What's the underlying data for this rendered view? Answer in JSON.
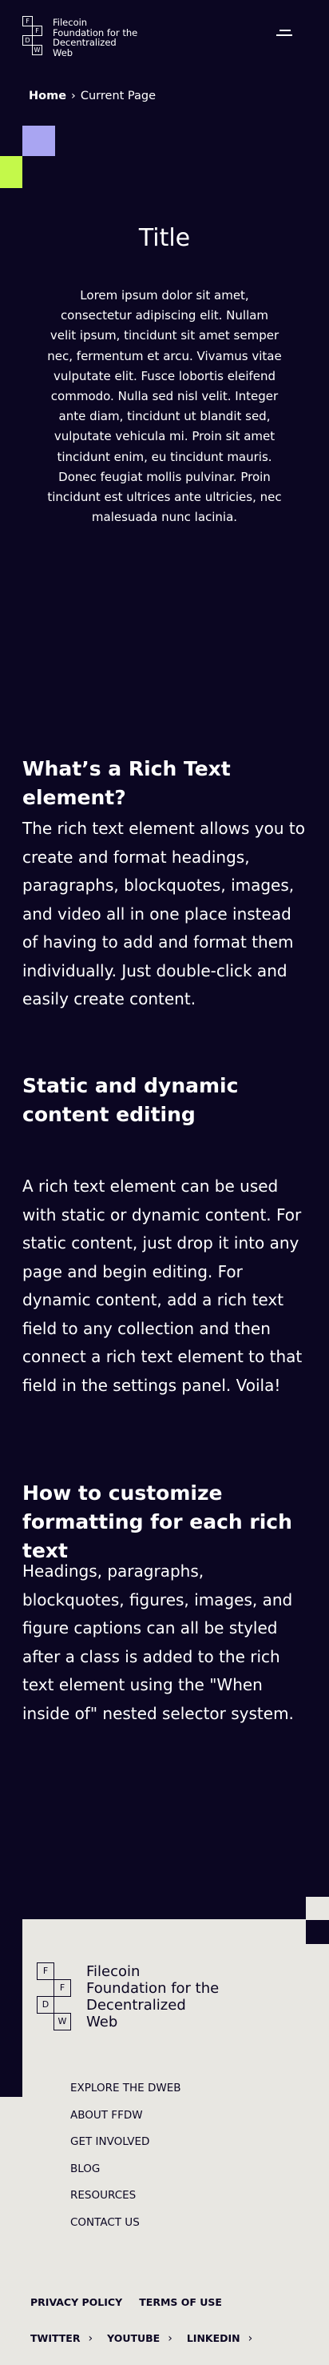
{
  "header": {
    "logo_cells": [
      "F",
      "F",
      "D",
      "W"
    ],
    "logo_text": [
      "Filecoin",
      "Foundation for the",
      "Decentralized",
      "Web"
    ],
    "menu_icon": "hamburger-menu-icon"
  },
  "breadcrumb": {
    "home": "Home",
    "separator": "›",
    "current": "Current Page"
  },
  "hero": {
    "title": "Title",
    "body": "Lorem ipsum dolor sit amet, consectetur adipiscing elit. Nullam velit ipsum, tincidunt sit amet semper nec, fermentum et arcu. Vivamus vitae vulputate elit. Fusce lobortis eleifend commodo. Nulla sed nisl velit. Integer ante diam, tincidunt ut blandit sed, vulputate vehicula mi. Proin sit amet tincidunt enim, eu tincidunt mauris. Donec feugiat mollis pulvinar. Proin tincidunt est ultrices ante ultricies, nec malesuada nunc lacinia."
  },
  "rich_text": {
    "h1": "What’s a Rich Text element?",
    "p1": "The rich text element allows you to create and format headings, paragraphs, blockquotes, images, and video all in one place instead of having to add and format them individually. Just double-click and easily create content.",
    "h2": "Static and dynamic content editing",
    "p2": "A rich text element can be used with static or dynamic content. For static content, just drop it into any page and begin editing. For dynamic content, add a rich text field to any collection and then connect a rich text element to that field in the settings panel. Voila!",
    "h3": "How to customize formatting for each rich text",
    "p3": "Headings, paragraphs, blockquotes, figures, images, and figure captions can all be styled after a class is added to the rich text element using the \"When inside of\" nested selector system."
  },
  "footer": {
    "logo_cells": [
      "F",
      "F",
      "D",
      "W"
    ],
    "logo_text": [
      "Filecoin",
      "Foundation for the",
      "Decentralized",
      "Web"
    ],
    "nav": [
      "EXPLORE THE DWEB",
      "ABOUT FFDW",
      "GET INVOLVED",
      "BLOG",
      "RESOURCES",
      "CONTACT US"
    ],
    "legal": [
      "PRIVACY POLICY",
      "TERMS OF USE"
    ],
    "social": [
      "TWITTER",
      "YOUTUBE",
      "LINKEDIN"
    ],
    "arrow": "›"
  },
  "colors": {
    "background": "#0b0622",
    "lavender_square": "#a9a5f2",
    "lime_square": "#c4f94a",
    "footer_background": "#e8e7e2"
  }
}
